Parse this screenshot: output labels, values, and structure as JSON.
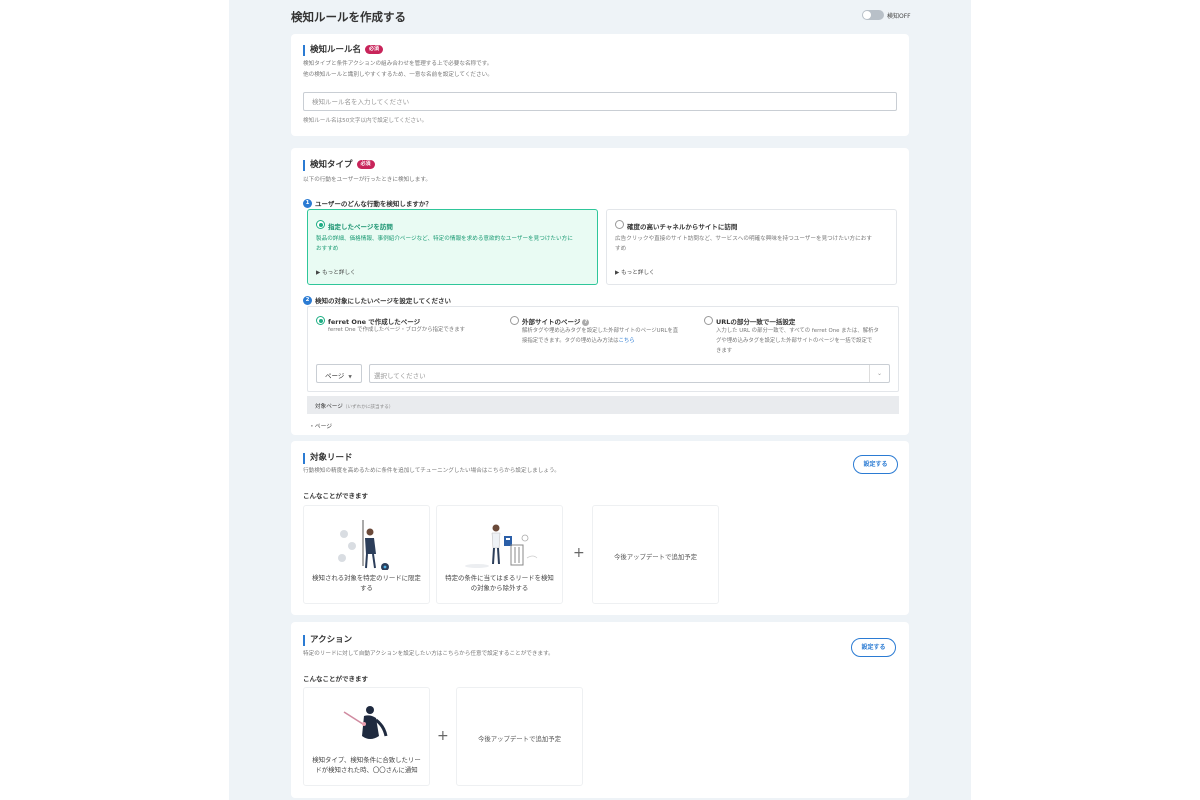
{
  "header": {
    "title": "検知ルールを作成する",
    "toggle_label": "検知OFF"
  },
  "rule_name": {
    "title": "検知ルール名",
    "required": "必須",
    "desc1": "検知タイプと条件アクションの組み合わせを管理する上で必要な名称です。",
    "desc2": "他の検知ルールと識別しやすくするため、一意な名前を設定してください。",
    "placeholder": "検知ルール名を入力してください",
    "hint": "検知ルール名は50文字以内で設定してください。"
  },
  "detect_type": {
    "title": "検知タイプ",
    "required": "必須",
    "desc": "以下の行動をユーザーが行ったときに検知します。",
    "q1_num": "1",
    "q1": "ユーザーのどんな行動を検知しますか？",
    "options": [
      {
        "title": "指定したページを訪問",
        "desc": "製品の詳細、価格情報、事例紹介ページなど、特定の情報を求める意欲的なユーザーを見つけたい方に",
        "desc2": "おすすめ",
        "more": "▶  もっと詳しく",
        "selected": true
      },
      {
        "title": "確度の高いチャネルからサイトに訪問",
        "desc": "広告クリックや直接のサイト訪問など、サービスへの明確な興味を持つユーザーを見つけたい方におす",
        "desc2": "すめ",
        "more": "▶  もっと詳しく",
        "selected": false
      }
    ],
    "q2_num": "2",
    "q2": "検知の対象にしたいページを設定してください",
    "targets": [
      {
        "title": "ferret One で作成したページ",
        "desc": [
          "ferret One で作成したページ・ブログから指定できます"
        ],
        "selected": true
      },
      {
        "title": "外部サイトのページ",
        "help": "?",
        "desc": [
          "解析タグや埋め込みタグを設定した外部サイトのページURLを直",
          "接指定できます。タグの埋め込み方法は"
        ],
        "link": "こちら",
        "selected": false
      },
      {
        "title": "URLの部分一致で一括設定",
        "desc": [
          "入力した URL の部分一致で、すべての ferret One または、解析タ",
          "グや埋め込みタグを設定した外部サイトのページを一括で設定で",
          "きます"
        ],
        "selected": false
      }
    ],
    "page_select": "ページ",
    "page_select_caret": "▼",
    "pick_placeholder": "選択してください",
    "pick_chevron": "⌄",
    "target_pages_label": "対象ページ",
    "target_pages_note": "（いずれかに該当する）",
    "target_item": "・ページ"
  },
  "target_lead": {
    "title": "対象リード",
    "desc": "行動検知の精度を高めるために条件を追加してチューニングしたい場合はこちらから設定しましょう。",
    "button": "設定する",
    "can_do": "こんなことができます",
    "features": [
      {
        "text": "検知される対象を特定のリードに限定する"
      },
      {
        "text": "特定の条件に当てはまるリードを検知の対象から除外する"
      },
      {
        "text": "今後アップデートで追加予定"
      }
    ],
    "plus": "+"
  },
  "action": {
    "title": "アクション",
    "desc": "特定のリードに対して自動アクションを設定したい方はこちらから任意で設定することができます。",
    "button": "設定する",
    "can_do": "こんなことができます",
    "features": [
      {
        "text": "検知タイプ、検知条件に合致したリードが検知された時、〇〇さんに通知"
      },
      {
        "text": "今後アップデートで追加予定"
      }
    ],
    "plus": "+"
  },
  "colors": {
    "accent": "#2b7bd3",
    "selected_border": "#2fc69a",
    "selected_bg": "#e9fbf3",
    "required_badge": "#c8245a",
    "canvas_bg": "#eef3f7"
  }
}
